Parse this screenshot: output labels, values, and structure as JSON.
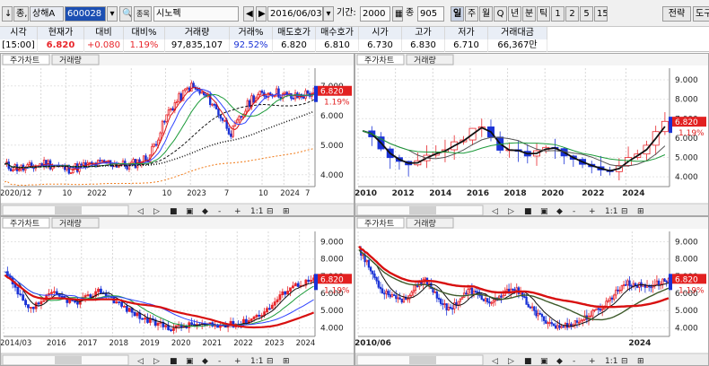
{
  "toolbar": {
    "down_arrow": "↓",
    "type_label": "종,",
    "market": "상해A",
    "code": "600028",
    "search_icon": "🔍",
    "badge": "종목",
    "name": "시노펙",
    "date": "2016/06/03",
    "period_label": "기간:",
    "period": "2000",
    "count_label": "종",
    "count": "905",
    "periods": [
      "일",
      "주",
      "월",
      "Q",
      "년",
      "분",
      "틱",
      "1",
      "2",
      "5",
      "15"
    ],
    "strategy": "전략",
    "more": "도구"
  },
  "quote": {
    "headers": [
      "시각",
      "현재가",
      "대비",
      "대비%",
      "거래량",
      "거래%",
      "매도호가",
      "매수호가",
      "시가",
      "고가",
      "저가",
      "거래대금"
    ],
    "values": [
      "[15:00]",
      "6.820",
      "+0.080",
      "1.19%",
      "97,835,107",
      "92.52%",
      "6.820",
      "6.810",
      "6.730",
      "6.830",
      "6.710",
      "66,367만"
    ]
  },
  "panel_tabs": [
    "주가차트",
    "거래량"
  ],
  "controls": [
    "◁",
    "▷",
    "■",
    "▣",
    "◆",
    "-",
    "+",
    "1:1",
    "⊟",
    "⊞"
  ],
  "price_tag": {
    "value": "6.820",
    "pct": "1.19%"
  },
  "panels": [
    {
      "y_ticks": [
        "7.000",
        "6.000",
        "5.000",
        "4.000"
      ],
      "x_labels": [
        "2020/12",
        "7",
        "10",
        "2022",
        "7",
        "10",
        "2023",
        "7",
        "10",
        "2024",
        "7"
      ]
    },
    {
      "y_ticks": [
        "9.000",
        "8.000",
        "7.000",
        "6.000",
        "5.000",
        "4.000"
      ],
      "x_labels": [
        "2010",
        "2012",
        "2014",
        "2016",
        "2018",
        "2020",
        "2022",
        "2024"
      ]
    },
    {
      "y_ticks": [
        "9.000",
        "8.000",
        "7.000",
        "6.000",
        "5.000",
        "4.000"
      ],
      "x_labels": [
        "2014/03",
        "2016",
        "2017",
        "2018",
        "2019",
        "2020",
        "2021",
        "2022",
        "2023",
        "2024"
      ]
    },
    {
      "y_ticks": [
        "9.000",
        "8.000",
        "7.000",
        "6.000",
        "5.000",
        "4.000"
      ],
      "x_labels": [
        "2010/06",
        "2024"
      ]
    }
  ],
  "colors": {
    "up": "#e8262b",
    "down": "#1a32d6",
    "ma_black": "#111111",
    "ma_green": "#1c9b3a",
    "ma_orange": "#f07a18",
    "ma_red": "#d81010",
    "ma_blue": "#3044ff",
    "tag": "#e22020"
  }
}
